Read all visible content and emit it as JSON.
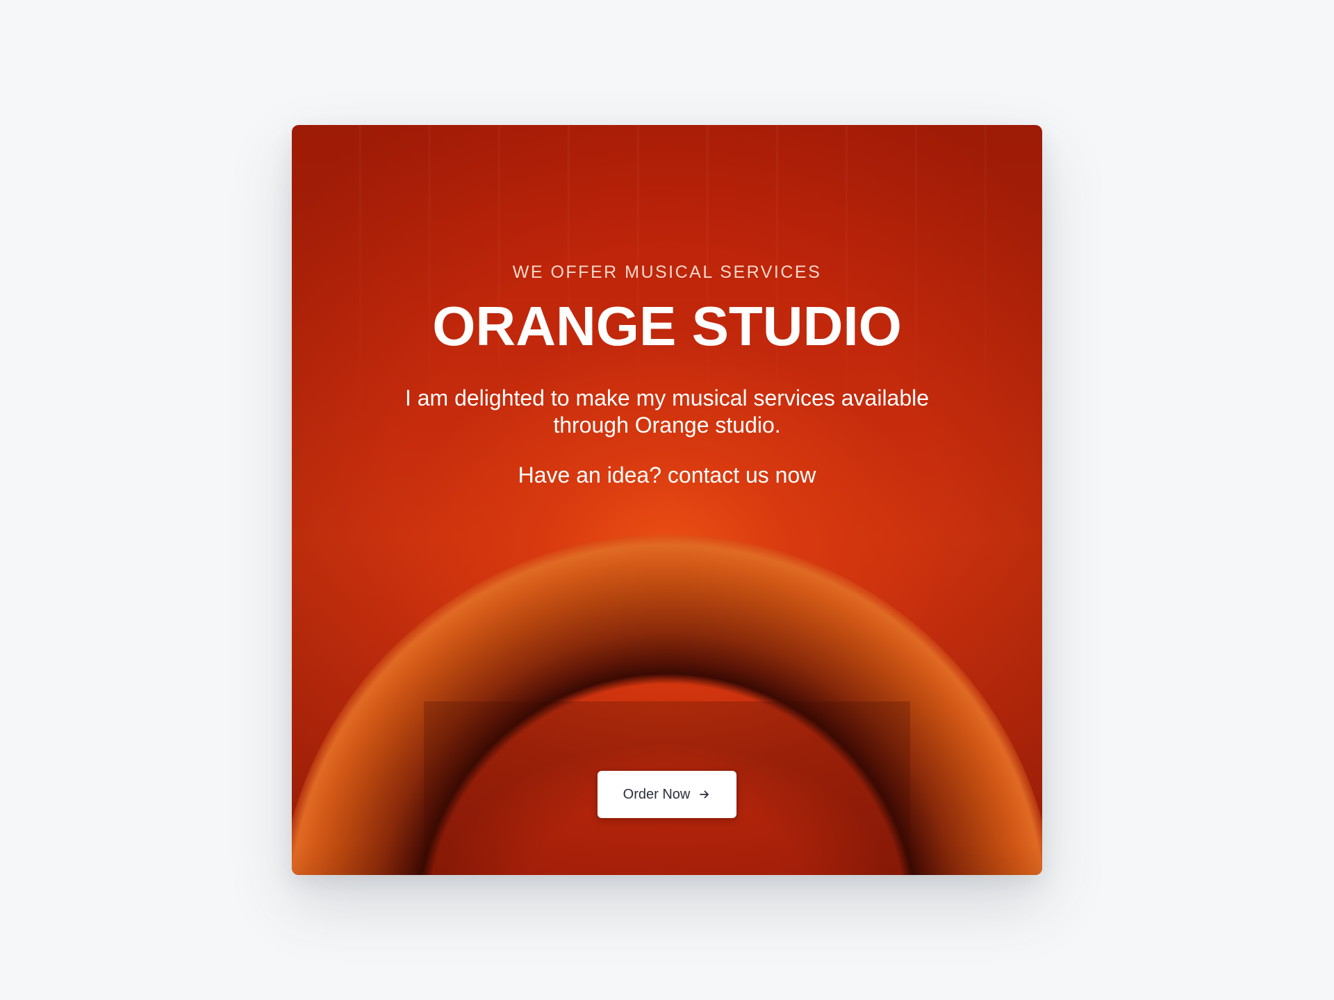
{
  "hero": {
    "eyebrow": "WE OFFER MUSICAL SERVICES",
    "title": "ORANGE STUDIO",
    "description": "I am delighted to make my musical services available through Orange studio.",
    "cta_text": "Have an idea? contact us now",
    "button_label": "Order Now",
    "button_icon": "arrow-right-icon"
  },
  "colors": {
    "page_background": "#f6f7f8",
    "card_primary": "#c42a0c",
    "card_glow": "#ec5114",
    "ring_highlight": "#e06a24",
    "text": "#ffffff",
    "eyebrow_text": "#f7d8cc",
    "button_background": "#ffffff",
    "button_text": "#2b2f3a"
  }
}
